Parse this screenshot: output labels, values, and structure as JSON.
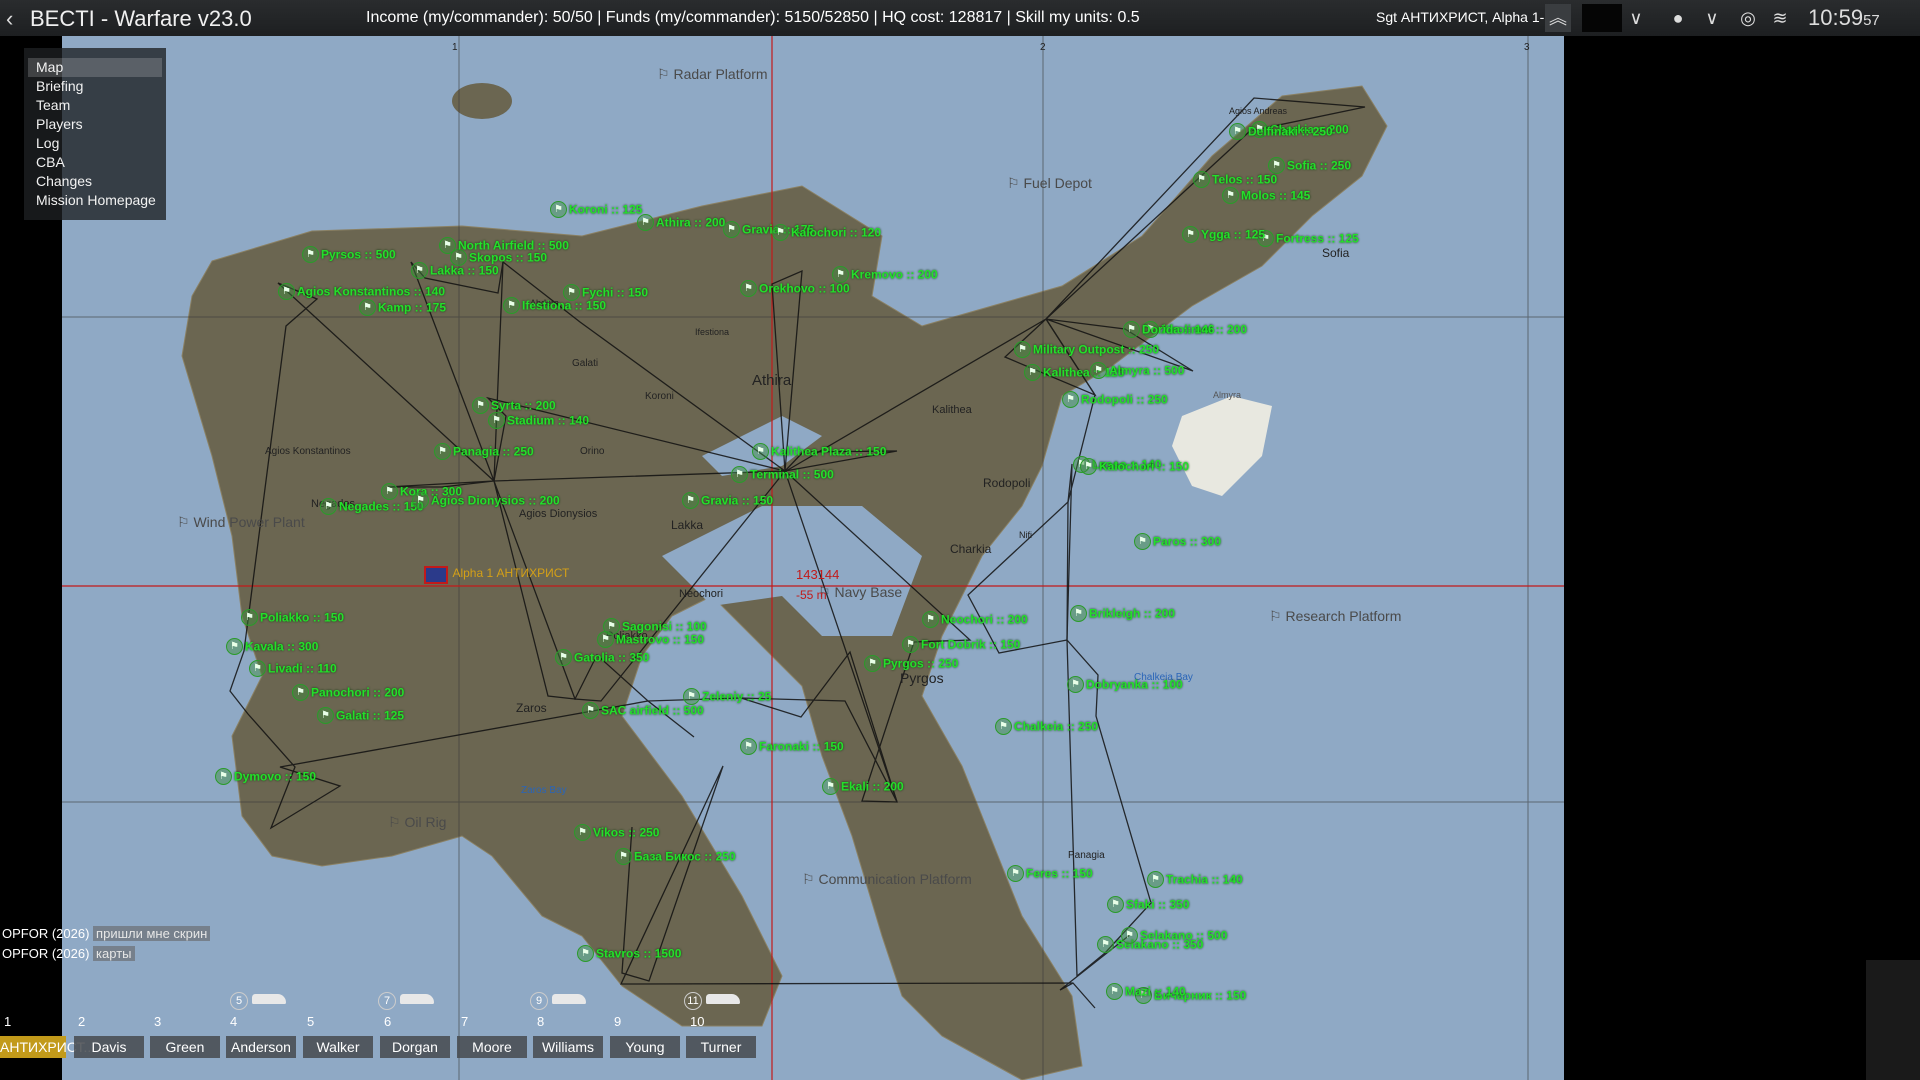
{
  "topbar": {
    "back_icon": "chevron-left-icon",
    "title": "BECTI - Warfare  v23.0",
    "stats": "Income (my/commander): 50/50 | Funds (my/commander): 5150/52850 | HQ cost: 128817 | Skill my units: 0.5",
    "player": "Sgt АНТИХРИСТ, Alpha 1-1 1",
    "clock_hm": "10:59",
    "clock_s": "57"
  },
  "menu": [
    "Map",
    "Briefing",
    "Team",
    "Players",
    "Log",
    "CBA",
    "Changes",
    "Mission Homepage"
  ],
  "map": {
    "grid_labels": [
      "1",
      "2",
      "3"
    ],
    "locations": [
      "Athira",
      "Kalithea",
      "Rodopoli",
      "Charkia",
      "Lakka",
      "Neochori",
      "Pyrgos",
      "Sofia",
      "Koroni",
      "Galati",
      "Orino",
      "Poliakko",
      "Zaros",
      "Negades",
      "Agios Konstantinos",
      "Agios Dionysios",
      "Abdera",
      "Ifestiona",
      "Nifi",
      "Almyra",
      "Panagia",
      "Agios Andreas",
      "Chalkeia Bay",
      "Zaros Bay"
    ],
    "poi": [
      "Radar Platform",
      "Fuel Depot",
      "Wind Power Plant",
      "Navy Base",
      "Research Platform",
      "Oil Rig",
      "Communication Platform"
    ],
    "towns": [
      "Pyrsos :: 500",
      "Agios Konstantinos :: 140",
      "Kamp :: 175",
      "Skopos :: 150",
      "North Airfield :: 500",
      "Lakka :: 150",
      "Koroni :: 125",
      "Athira :: 200",
      "Gravia :: 175",
      "Kalochori :: 120",
      "Kremovo :: 200",
      "Fychi :: 150",
      "Ifestiona :: 150",
      "Orekhovo :: 100",
      "Stadium :: 140",
      "Syrta :: 200",
      "Panagia :: 250",
      "Kora :: 300",
      "Negades :: 150",
      "Agios Dionysios :: 200",
      "Terminal :: 500",
      "Kalithea Plaza :: 150",
      "Gravia :: 150",
      "Feres :: 150",
      "Rodopoli :: 250",
      "Kalithea :: 125",
      "Military Outpost :: 250",
      "Almyra :: 500",
      "Xirolimni :: 200",
      "Dorida :: 146",
      "Neochori :: 200",
      "Chalkeia :: 250",
      "Lasso :: 140",
      "Pyrgos :: 250",
      "Fort Dobrik :: 150",
      "Dobryanka :: 100",
      "Brikleigh :: 200",
      "Kalochori :: 150",
      "Poliakko :: 150",
      "Kavala :: 300",
      "Livadi :: 110",
      "Vikos :: 250",
      "Selakano :: 350",
      "Panochori :: 200",
      "Galati :: 125",
      "Dymovo :: 150",
      "Gatolia :: 350",
      "SAC airfield :: 500",
      "Mastrovo :: 150",
      "База Бикос :: 250",
      "Stavros :: 1500",
      "Trachia :: 140",
      "Sfaki :: 350",
      "Selakano :: 500",
      "Бичарник :: 150",
      "Mazi :: 140",
      "Faronaki :: 150",
      "Ekali :: 200",
      "Paros :: 300",
      "Charkia :: 200",
      "Delfinaki :: 250",
      "Sofia :: 250",
      "Telos :: 150",
      "Molos :: 145",
      "Fortress :: 125",
      "Ygga :: 125",
      "Zeleniy :: 25",
      "Sagonisi :: 100"
    ],
    "player_marker": "Alpha 1 АНТИХРИСТ",
    "cursor_readout": "143144",
    "cursor_depth": "-55 m"
  },
  "chat": [
    {
      "who": "OPFOR (2026)",
      "msg": "пришли мне скрин"
    },
    {
      "who": "OPFOR (2026)",
      "msg": "карты"
    }
  ],
  "squad": {
    "slots": [
      {
        "num": "1",
        "name": "АНТИХРИСТ..."
      },
      {
        "num": "2",
        "name": "Davis"
      },
      {
        "num": "3",
        "name": "Green"
      },
      {
        "num": "4",
        "name": "Anderson"
      },
      {
        "num": "5",
        "name": "Walker"
      },
      {
        "num": "6",
        "name": "Dorgan"
      },
      {
        "num": "7",
        "name": "Moore"
      },
      {
        "num": "8",
        "name": "Williams"
      },
      {
        "num": "9",
        "name": "Young"
      },
      {
        "num": "10",
        "name": "Turner"
      }
    ],
    "vehicle_counts": [
      "5",
      "7",
      "9",
      "11"
    ]
  },
  "colors": {
    "town": "#23e02a",
    "grid_red": "#c21a1a",
    "sea": "#8fa9c5",
    "land": "#6b6651",
    "selected_slot": "#c29a1a"
  }
}
